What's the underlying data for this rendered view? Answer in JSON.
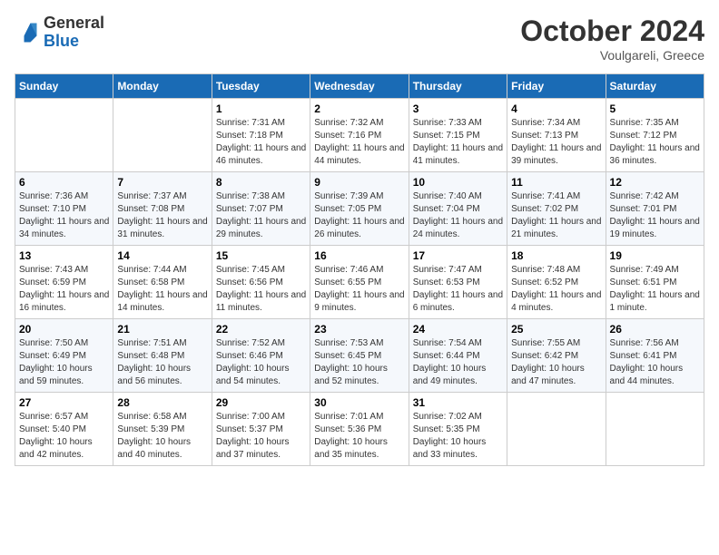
{
  "logo": {
    "general": "General",
    "blue": "Blue"
  },
  "title": "October 2024",
  "location": "Voulgareli, Greece",
  "days_header": [
    "Sunday",
    "Monday",
    "Tuesday",
    "Wednesday",
    "Thursday",
    "Friday",
    "Saturday"
  ],
  "weeks": [
    [
      {
        "day": "",
        "info": ""
      },
      {
        "day": "",
        "info": ""
      },
      {
        "day": "1",
        "info": "Sunrise: 7:31 AM\nSunset: 7:18 PM\nDaylight: 11 hours and 46 minutes."
      },
      {
        "day": "2",
        "info": "Sunrise: 7:32 AM\nSunset: 7:16 PM\nDaylight: 11 hours and 44 minutes."
      },
      {
        "day": "3",
        "info": "Sunrise: 7:33 AM\nSunset: 7:15 PM\nDaylight: 11 hours and 41 minutes."
      },
      {
        "day": "4",
        "info": "Sunrise: 7:34 AM\nSunset: 7:13 PM\nDaylight: 11 hours and 39 minutes."
      },
      {
        "day": "5",
        "info": "Sunrise: 7:35 AM\nSunset: 7:12 PM\nDaylight: 11 hours and 36 minutes."
      }
    ],
    [
      {
        "day": "6",
        "info": "Sunrise: 7:36 AM\nSunset: 7:10 PM\nDaylight: 11 hours and 34 minutes."
      },
      {
        "day": "7",
        "info": "Sunrise: 7:37 AM\nSunset: 7:08 PM\nDaylight: 11 hours and 31 minutes."
      },
      {
        "day": "8",
        "info": "Sunrise: 7:38 AM\nSunset: 7:07 PM\nDaylight: 11 hours and 29 minutes."
      },
      {
        "day": "9",
        "info": "Sunrise: 7:39 AM\nSunset: 7:05 PM\nDaylight: 11 hours and 26 minutes."
      },
      {
        "day": "10",
        "info": "Sunrise: 7:40 AM\nSunset: 7:04 PM\nDaylight: 11 hours and 24 minutes."
      },
      {
        "day": "11",
        "info": "Sunrise: 7:41 AM\nSunset: 7:02 PM\nDaylight: 11 hours and 21 minutes."
      },
      {
        "day": "12",
        "info": "Sunrise: 7:42 AM\nSunset: 7:01 PM\nDaylight: 11 hours and 19 minutes."
      }
    ],
    [
      {
        "day": "13",
        "info": "Sunrise: 7:43 AM\nSunset: 6:59 PM\nDaylight: 11 hours and 16 minutes."
      },
      {
        "day": "14",
        "info": "Sunrise: 7:44 AM\nSunset: 6:58 PM\nDaylight: 11 hours and 14 minutes."
      },
      {
        "day": "15",
        "info": "Sunrise: 7:45 AM\nSunset: 6:56 PM\nDaylight: 11 hours and 11 minutes."
      },
      {
        "day": "16",
        "info": "Sunrise: 7:46 AM\nSunset: 6:55 PM\nDaylight: 11 hours and 9 minutes."
      },
      {
        "day": "17",
        "info": "Sunrise: 7:47 AM\nSunset: 6:53 PM\nDaylight: 11 hours and 6 minutes."
      },
      {
        "day": "18",
        "info": "Sunrise: 7:48 AM\nSunset: 6:52 PM\nDaylight: 11 hours and 4 minutes."
      },
      {
        "day": "19",
        "info": "Sunrise: 7:49 AM\nSunset: 6:51 PM\nDaylight: 11 hours and 1 minute."
      }
    ],
    [
      {
        "day": "20",
        "info": "Sunrise: 7:50 AM\nSunset: 6:49 PM\nDaylight: 10 hours and 59 minutes."
      },
      {
        "day": "21",
        "info": "Sunrise: 7:51 AM\nSunset: 6:48 PM\nDaylight: 10 hours and 56 minutes."
      },
      {
        "day": "22",
        "info": "Sunrise: 7:52 AM\nSunset: 6:46 PM\nDaylight: 10 hours and 54 minutes."
      },
      {
        "day": "23",
        "info": "Sunrise: 7:53 AM\nSunset: 6:45 PM\nDaylight: 10 hours and 52 minutes."
      },
      {
        "day": "24",
        "info": "Sunrise: 7:54 AM\nSunset: 6:44 PM\nDaylight: 10 hours and 49 minutes."
      },
      {
        "day": "25",
        "info": "Sunrise: 7:55 AM\nSunset: 6:42 PM\nDaylight: 10 hours and 47 minutes."
      },
      {
        "day": "26",
        "info": "Sunrise: 7:56 AM\nSunset: 6:41 PM\nDaylight: 10 hours and 44 minutes."
      }
    ],
    [
      {
        "day": "27",
        "info": "Sunrise: 6:57 AM\nSunset: 5:40 PM\nDaylight: 10 hours and 42 minutes."
      },
      {
        "day": "28",
        "info": "Sunrise: 6:58 AM\nSunset: 5:39 PM\nDaylight: 10 hours and 40 minutes."
      },
      {
        "day": "29",
        "info": "Sunrise: 7:00 AM\nSunset: 5:37 PM\nDaylight: 10 hours and 37 minutes."
      },
      {
        "day": "30",
        "info": "Sunrise: 7:01 AM\nSunset: 5:36 PM\nDaylight: 10 hours and 35 minutes."
      },
      {
        "day": "31",
        "info": "Sunrise: 7:02 AM\nSunset: 5:35 PM\nDaylight: 10 hours and 33 minutes."
      },
      {
        "day": "",
        "info": ""
      },
      {
        "day": "",
        "info": ""
      }
    ]
  ]
}
